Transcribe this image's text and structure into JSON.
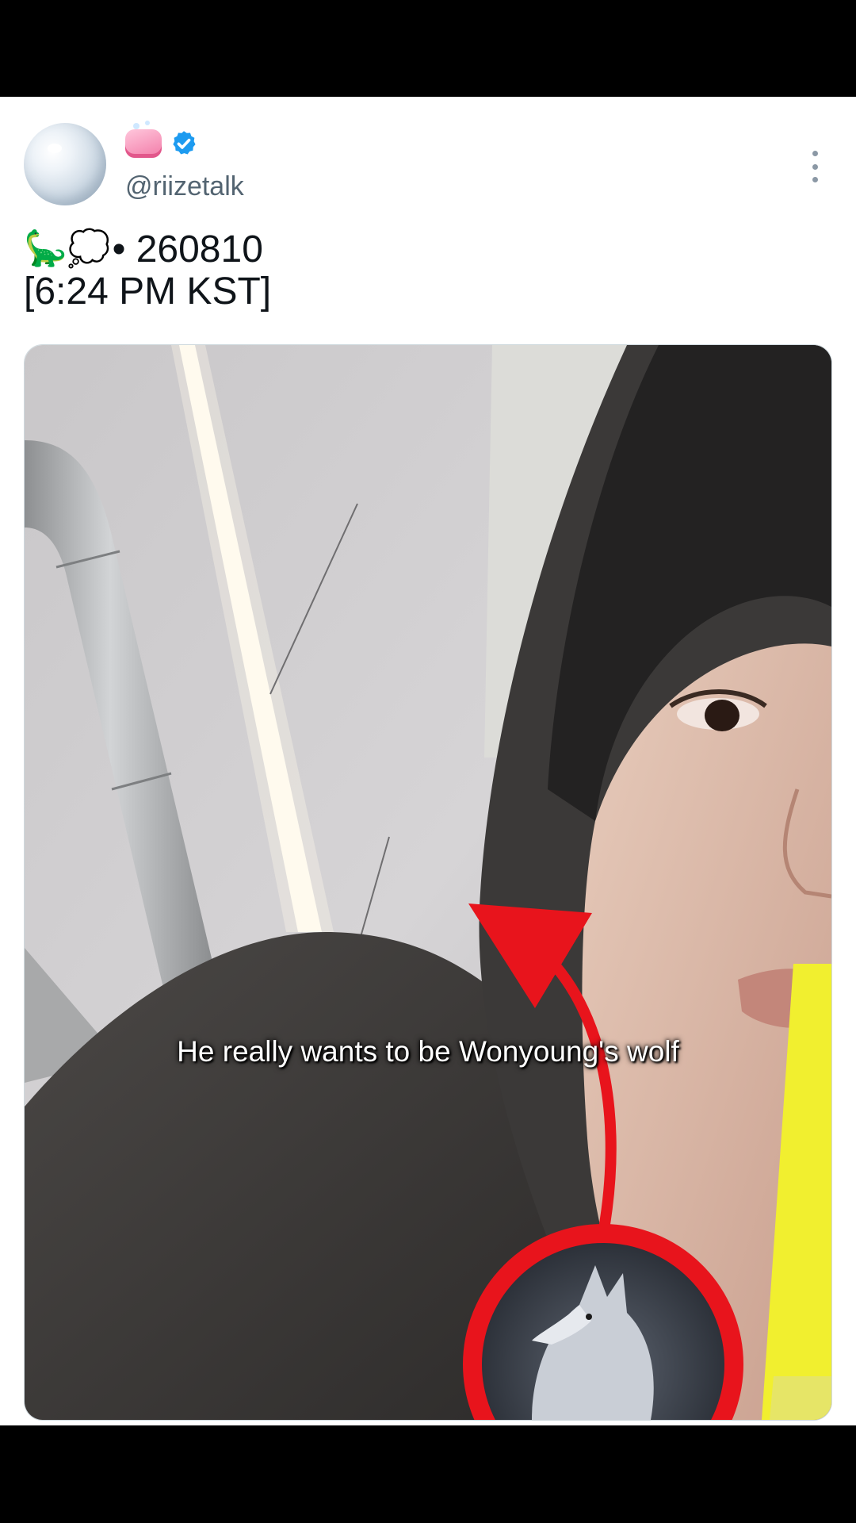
{
  "post": {
    "handle": "@riizetalk",
    "line1_emoji": "🦕💭",
    "line1_text": "• 260810",
    "line2_text": "[6:24 PM KST]",
    "icons": {
      "avatar": "bubble-avatar",
      "badge_emoji": "soap-icon",
      "verified": "verified-badge-icon",
      "more": "more-vertical-icon"
    },
    "colors": {
      "verified": "#1d9bf0",
      "handle": "#536471",
      "text": "#0f1419"
    }
  },
  "image": {
    "caption": "He really wants to be Wonyoung's wolf",
    "overlay": {
      "arrow_color": "#e8141c",
      "circle_color": "#e8141c",
      "inset_content": "wolf-illustration"
    }
  }
}
